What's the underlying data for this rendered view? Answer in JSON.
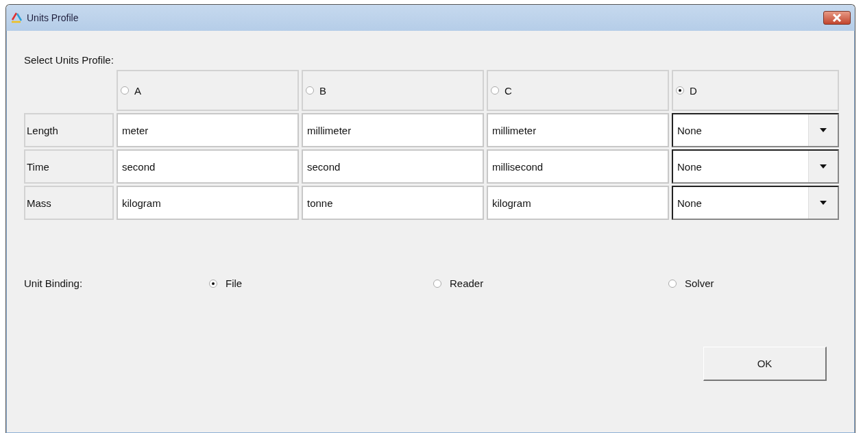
{
  "window": {
    "title": "Units Profile"
  },
  "profile_label": "Select Units Profile:",
  "profiles": [
    {
      "label": "A",
      "selected": false
    },
    {
      "label": "B",
      "selected": false
    },
    {
      "label": "C",
      "selected": false
    },
    {
      "label": "D",
      "selected": true
    }
  ],
  "rows": [
    {
      "label": "Length",
      "cells": [
        {
          "kind": "text",
          "value": "meter"
        },
        {
          "kind": "text",
          "value": "millimeter"
        },
        {
          "kind": "text",
          "value": "millimeter"
        },
        {
          "kind": "dropdown",
          "value": "None"
        }
      ]
    },
    {
      "label": "Time",
      "cells": [
        {
          "kind": "text",
          "value": "second"
        },
        {
          "kind": "text",
          "value": "second"
        },
        {
          "kind": "text",
          "value": "millisecond"
        },
        {
          "kind": "dropdown",
          "value": "None"
        }
      ]
    },
    {
      "label": "Mass",
      "cells": [
        {
          "kind": "text",
          "value": "kilogram"
        },
        {
          "kind": "text",
          "value": "tonne"
        },
        {
          "kind": "text",
          "value": "kilogram"
        },
        {
          "kind": "dropdown",
          "value": "None"
        }
      ]
    }
  ],
  "binding": {
    "label": "Unit Binding:",
    "options": [
      {
        "label": "File",
        "selected": true
      },
      {
        "label": "Reader",
        "selected": false
      },
      {
        "label": "Solver",
        "selected": false
      }
    ]
  },
  "buttons": [
    "OK"
  ]
}
